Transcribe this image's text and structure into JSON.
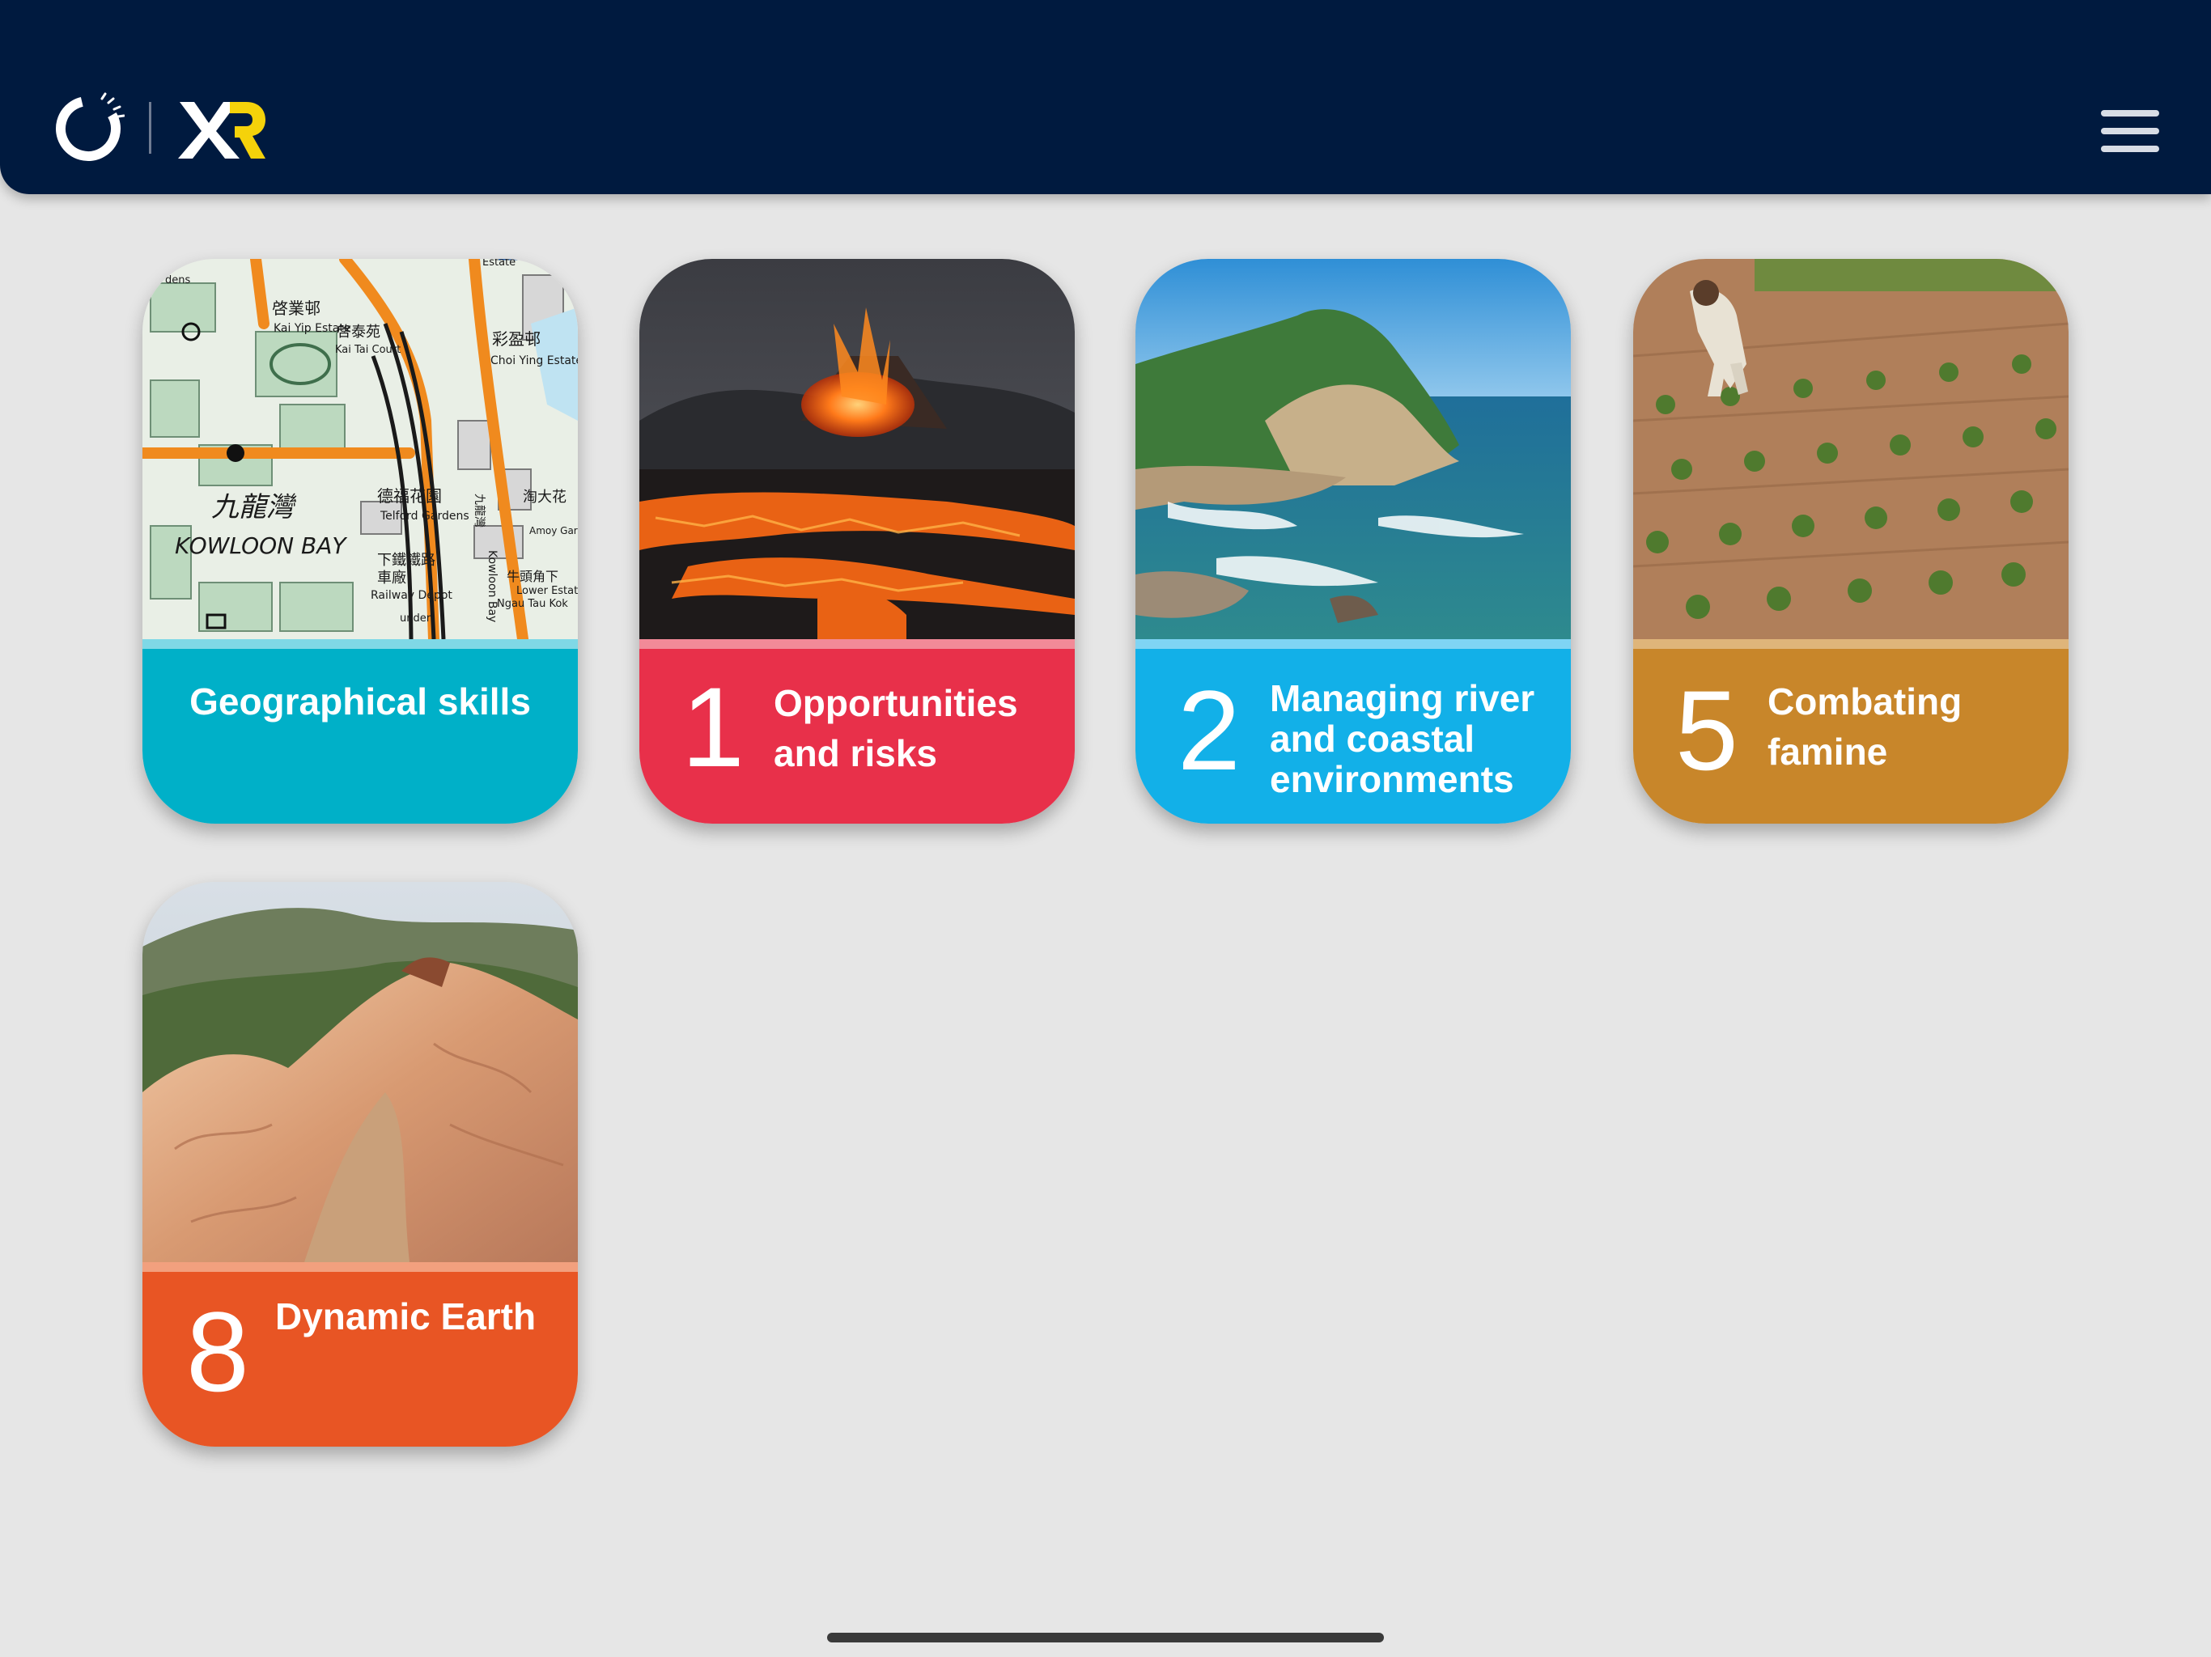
{
  "colors": {
    "header_bg": "#001a3f",
    "page_bg": "#e6e6e6",
    "xr_accent": "#f5d20a"
  },
  "header": {
    "logo_icon": "publisher-ring-logo",
    "xr_logo_icon": "xr-logo",
    "menu_icon": "hamburger-menu-icon"
  },
  "cards": [
    {
      "number": "",
      "title": "Geographical skills",
      "color": "#00b0c8",
      "stripe": "#7fd8e6",
      "image_icon": "topographic-map-image",
      "map_labels": [
        "九龍灣",
        "KOWLOON BAY",
        "啓業邨",
        "Kai Yip Estate",
        "啓泰苑",
        "Kai Tai Court",
        "彩盈邨",
        "Choi Ying Estate",
        "德福花園",
        "Telford Gardens",
        "下鐵鐵路",
        "車廠",
        "Railway Depot",
        "牛頭角下",
        "Ngau Tau Kok",
        "Lower Estate",
        "淘大花",
        "Amoy Gardens",
        "九龍灣",
        "Kowloon Bay",
        "Estate",
        "dens",
        "under"
      ]
    },
    {
      "number": "1",
      "title": "Opportunities and risks",
      "color": "#e8304a",
      "stripe": "#f28a98",
      "image_icon": "volcano-lava-image"
    },
    {
      "number": "2",
      "title": "Managing river and coastal environments",
      "color": "#12b0e8",
      "stripe": "#7fd4f4",
      "image_icon": "coastal-cliff-image"
    },
    {
      "number": "5",
      "title": "Combating famine",
      "color": "#c8862a",
      "stripe": "#dfb57a",
      "image_icon": "farm-field-image"
    },
    {
      "number": "8",
      "title": "Dynamic Earth",
      "color": "#e85524",
      "stripe": "#f2a07e",
      "image_icon": "eroded-hills-image"
    }
  ]
}
